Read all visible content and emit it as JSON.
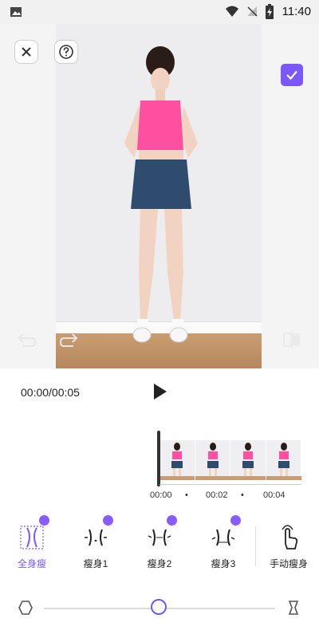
{
  "status_bar": {
    "time": "11:40"
  },
  "preview": {
    "close_icon": "close-icon",
    "help_icon": "question-icon",
    "confirm_icon": "checkmark-icon",
    "undo_icon": "undo-icon",
    "redo_icon": "redo-icon",
    "compare_icon": "compare-icon",
    "accent_color": "#7b57ff",
    "top_color": "#ff4fa0",
    "skirt_color": "#2f4b6e"
  },
  "playback": {
    "time_display": "00:00/00:05",
    "play_icon": "play-icon",
    "timeline_ticks": [
      "00:00",
      "•",
      "00:02",
      "•",
      "00:04"
    ]
  },
  "tools": [
    {
      "label": "全身瘦",
      "icon": "full-body-slim-icon",
      "active": true,
      "premium": true
    },
    {
      "label": "瘦身1",
      "icon": "slim-1-icon",
      "premium": true
    },
    {
      "label": "瘦身2",
      "icon": "slim-2-icon",
      "premium": true
    },
    {
      "label": "瘦身3",
      "icon": "slim-3-icon",
      "premium": true
    },
    {
      "label": "手动瘦身",
      "icon": "manual-slim-icon",
      "premium": false
    }
  ],
  "slider": {
    "level": 0.52,
    "left_icon": "thin-shape-icon",
    "right_icon": "wide-shape-icon"
  }
}
